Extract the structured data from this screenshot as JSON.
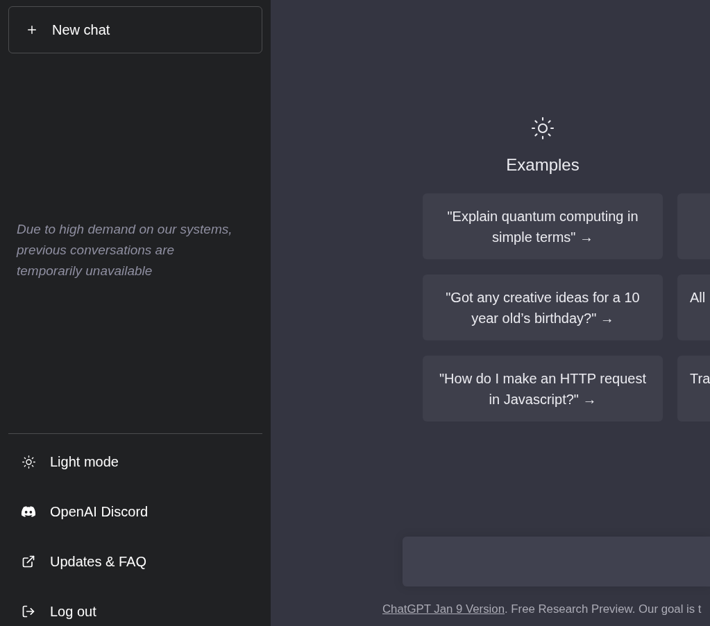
{
  "sidebar": {
    "new_chat": {
      "label": "New chat"
    },
    "notice": "Due to high demand on our systems, previous conversations are temporarily unavailable",
    "menu": [
      {
        "kind": "theme",
        "label": "Light mode"
      },
      {
        "kind": "discord",
        "label": "OpenAI Discord"
      },
      {
        "kind": "external",
        "label": "Updates & FAQ"
      },
      {
        "kind": "logout",
        "label": "Log out"
      }
    ]
  },
  "main": {
    "columns": [
      {
        "heading": "Examples",
        "cards": [
          {
            "kind": "prompt",
            "text": "\"Explain quantum computing in simple terms\" →"
          },
          {
            "kind": "prompt",
            "text": "\"Got any creative ideas for a 10 year old’s birthday?\" →"
          },
          {
            "kind": "prompt",
            "text": "\"How do I make an HTTP request in Javascript?\" →"
          }
        ]
      },
      {
        "cards": [
          {
            "kind": "blank"
          },
          {
            "kind": "partial",
            "text": "All"
          },
          {
            "kind": "partial",
            "text": "Tra"
          }
        ]
      }
    ],
    "footer": {
      "link": "ChatGPT Jan 9 Version",
      "text": ". Free Research Preview. Our goal is t"
    }
  }
}
